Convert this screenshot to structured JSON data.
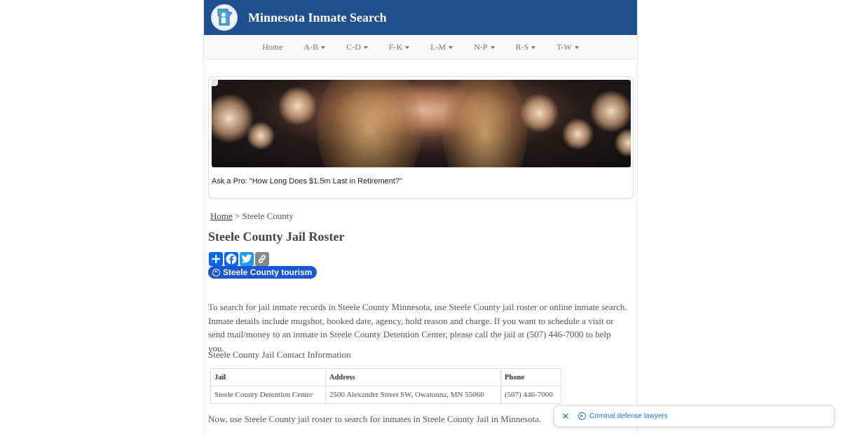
{
  "header": {
    "site_title": "Minnesota Inmate Search",
    "background": "#1f4f8f"
  },
  "nav": {
    "home": "Home",
    "menus": [
      "A-B",
      "C-D",
      "F-K",
      "L-M",
      "N-P",
      "R-S",
      "T-W"
    ]
  },
  "ad": {
    "caption": "Ask a Pro: \"How Long Does $1.5m Last in Retirement?\""
  },
  "breadcrumb": {
    "home": "Home",
    "separator": ">",
    "current": "Steele County"
  },
  "page_title": "Steele County Jail Roster",
  "share": {
    "buttons": [
      {
        "icon": "add-icon",
        "color": "#0166ff"
      },
      {
        "icon": "facebook-icon",
        "color": "#0866ff"
      },
      {
        "icon": "twitter-icon",
        "color": "#1d9bf0"
      },
      {
        "icon": "copy-link-icon",
        "color": "#888888"
      }
    ]
  },
  "tourism_pill": {
    "label": "Steele County tourism",
    "color": "#1a56d6"
  },
  "intro_text": "To search for jail inmate records in Steele County Minnesota, use Steele County jail roster or online inmate search. Inmate details include mugshot, booked date, agency, hold reason and charge. If you want to schedule a visit or send mail/money to an inmate in Steele County Detention Center, please call the jail at (507) 446-7000 to help you.",
  "contact_heading": "Steele County Jail Contact Information",
  "contact_table": {
    "headers": {
      "jail": "Jail",
      "address": "Address",
      "phone": "Phone"
    },
    "row": {
      "jail": "Steele County Detention Center",
      "address": "2500 Alexander Street SW, Owatonna, MN 55060",
      "phone": "(507) 446-7000"
    }
  },
  "outro_text": "Now, use Steele County jail roster to search for inmates in Steele County Jail in Minnesota.",
  "bottom_ad": {
    "close_icon": "close-icon",
    "link_label": "Criminal defense lawyers",
    "accent": "#1a73e8"
  }
}
